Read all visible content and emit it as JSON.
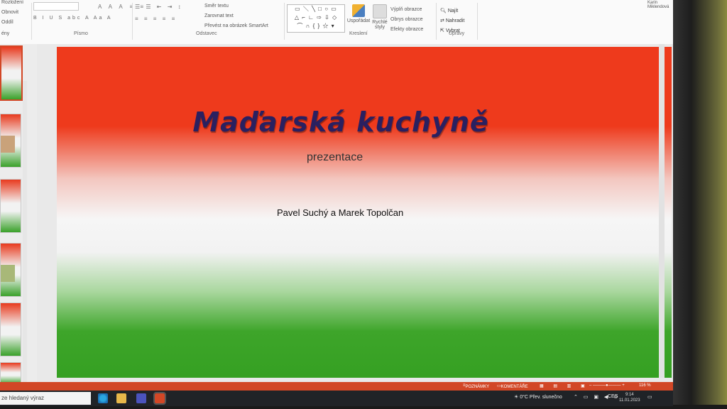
{
  "ribbon": {
    "left_items": [
      "Rozložení",
      "Obnovit",
      "Oddíl",
      "ény"
    ],
    "font_group": "Písmo",
    "paragraph_group": "Odstavec",
    "paragraph_cmds": [
      "Směr textu",
      "Zarovnat text",
      "Převést na obrázek SmartArt"
    ],
    "drawing_group": "Kreslení",
    "arrange_label": "Uspořádat",
    "quick_styles_label": "Rychlé styly",
    "style_cmds": [
      "Výplň obrazce",
      "Obrys obrazce",
      "Efekty obrazce"
    ],
    "editing_group": "Úpravy",
    "editing_cmds": [
      "Najít",
      "Nahradit",
      "Vybrat"
    ],
    "user_name": "Karin Miklendová"
  },
  "slide": {
    "title": "Maďarská kuchyně",
    "subtitle": "prezentace",
    "authors": "Pavel Suchý a Marek Topolčan"
  },
  "statusbar": {
    "notes": "POZNÁMKY",
    "comments": "KOMENTÁŘE",
    "zoom": "116 %"
  },
  "taskbar": {
    "search_placeholder": "ze hledaný výraz",
    "weather": "0°C  Přev. slunečno",
    "language": "CES",
    "time": "9:14",
    "date": "11.01.2023"
  }
}
